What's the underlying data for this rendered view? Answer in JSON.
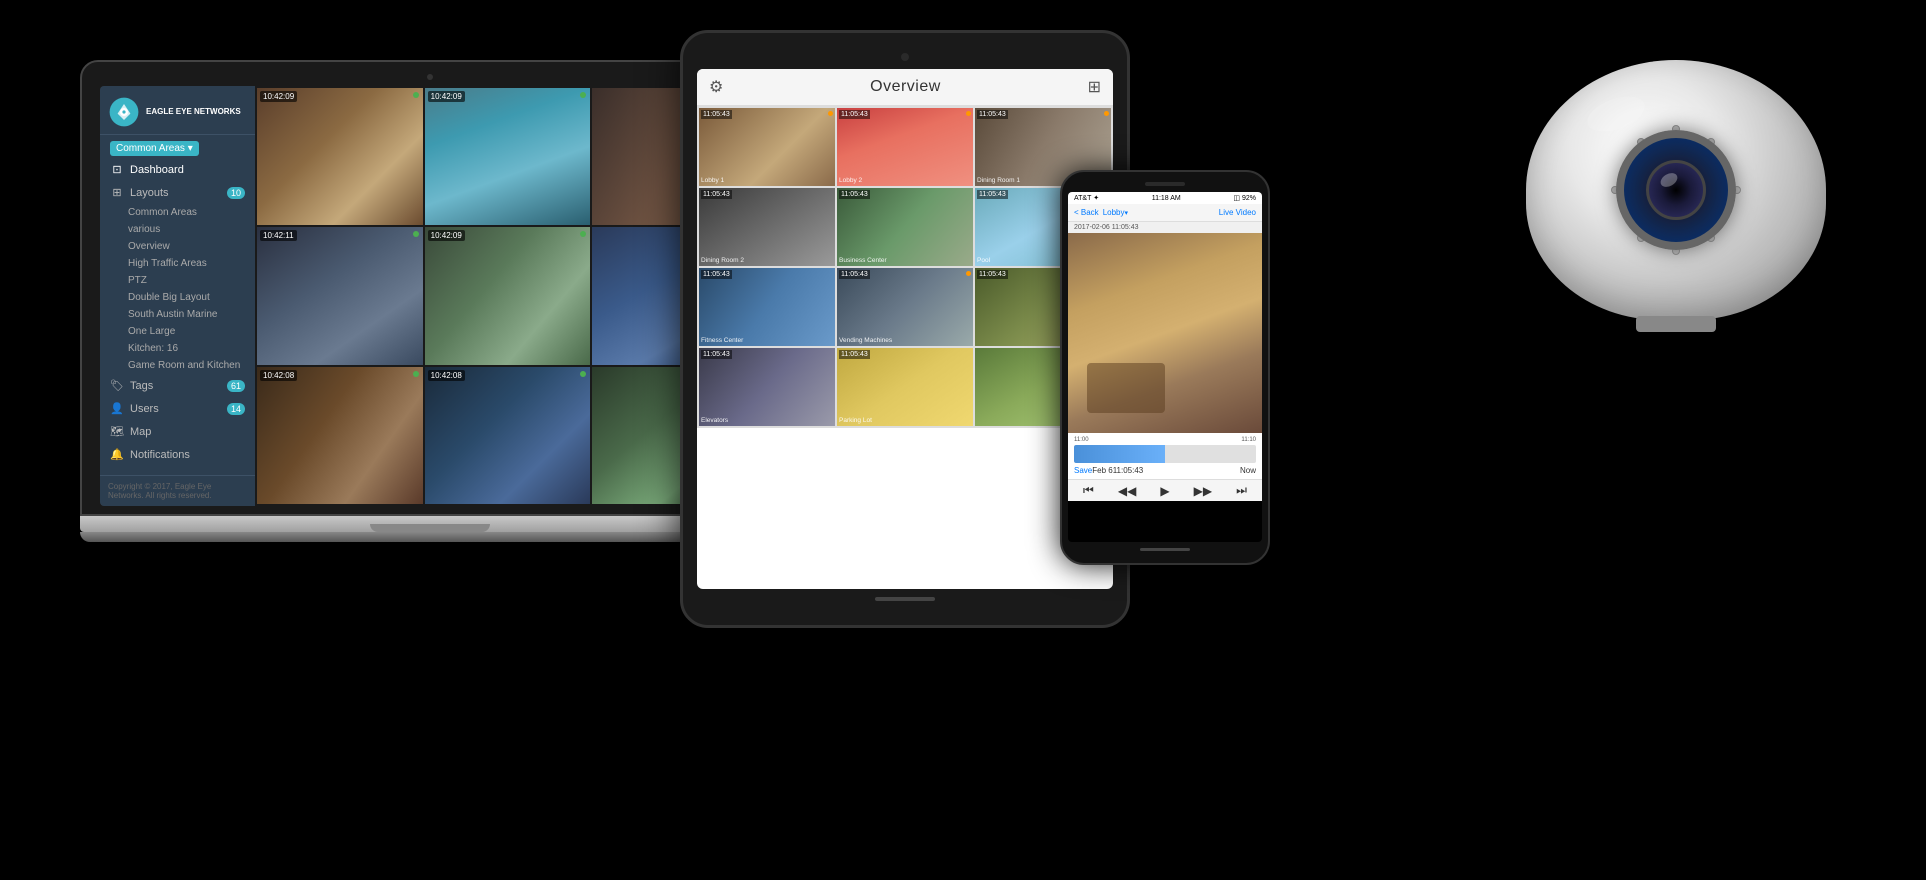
{
  "app": {
    "name": "Eagle Eye Networks"
  },
  "laptop": {
    "sidebar": {
      "logo_text": "EAGLE EYE\nNETWORKS, INC.",
      "location_label": "Common Areas ▾",
      "nav_items": [
        {
          "icon": "⊞",
          "label": "Dashboard",
          "badge": null
        },
        {
          "icon": "⊞",
          "label": "Layouts",
          "badge": "10"
        },
        {
          "icon": "🏷",
          "label": "Tags",
          "badge": "61"
        },
        {
          "icon": "👤",
          "label": "Users",
          "badge": "14"
        },
        {
          "icon": "🗺",
          "label": "Map",
          "badge": null
        },
        {
          "icon": "🔔",
          "label": "Notifications",
          "badge": null
        }
      ],
      "sub_items": [
        "Common Areas",
        "various",
        "Overview",
        "High Traffic Areas",
        "PTZ",
        "Double Big Layout",
        "South Austin Marine",
        "One Large",
        "Kitchen: 16",
        "Game Room and Kitchen"
      ],
      "footer": "Copyright © 2017, Eagle Eye Networks.\nAll rights reserved."
    },
    "cameras": [
      {
        "time": "10:42:09",
        "status": "green"
      },
      {
        "time": "10:42:09",
        "status": "green"
      },
      {
        "time": "",
        "status": ""
      },
      {
        "time": "10:42:11",
        "status": "green"
      },
      {
        "time": "10:42:09",
        "status": "green"
      },
      {
        "time": "",
        "status": ""
      },
      {
        "time": "10:42:08",
        "status": "green"
      },
      {
        "time": "10:42:08",
        "status": "green"
      },
      {
        "time": "",
        "status": ""
      }
    ]
  },
  "tablet": {
    "header": {
      "title": "Overview",
      "gear_icon": "⚙",
      "grid_icon": "⊞"
    },
    "cameras": [
      {
        "time": "11:05:43",
        "name": "Lobby 1",
        "dot": "orange"
      },
      {
        "time": "11:05:43",
        "name": "Lobby 2",
        "dot": "orange"
      },
      {
        "time": "11:05:43",
        "name": "Dining Room 1",
        "dot": "orange"
      },
      {
        "time": "11:05:43",
        "name": "Dining Room 2",
        "dot": ""
      },
      {
        "time": "11:05:43",
        "name": "Business Center",
        "dot": ""
      },
      {
        "time": "11:05:43",
        "name": "Pool",
        "dot": ""
      },
      {
        "time": "11:05:43",
        "name": "Fitness Center",
        "dot": ""
      },
      {
        "time": "11:05:43",
        "name": "Vending Machines",
        "dot": "orange"
      },
      {
        "time": "11:05:43",
        "name": "",
        "dot": ""
      },
      {
        "time": "11:05:43",
        "name": "Elevators",
        "dot": ""
      },
      {
        "time": "11:05:43",
        "name": "Parking Lot",
        "dot": ""
      },
      {
        "time": "",
        "name": "",
        "dot": ""
      }
    ]
  },
  "phone": {
    "status_bar": {
      "carrier": "AT&T ✦",
      "time": "11:18 AM",
      "battery": "◫ 92%"
    },
    "nav": {
      "back_label": "< Back",
      "location": "Lobby",
      "location_arrow": "▾",
      "live_label": "Live Video"
    },
    "date_label": "2017-02-06 11:05:43",
    "timeline": {
      "label_left": "11:00",
      "label_right": "11:10"
    },
    "controls": {
      "save_label": "Save",
      "date_label": "Feb 6",
      "time_label": "11:05:43",
      "now_label": "Now"
    },
    "playback": {
      "buttons": [
        "⏮",
        "◀◀",
        "▶",
        "▶▶",
        "⏭"
      ]
    }
  },
  "camera_device": {
    "type": "dome",
    "alt": "Security dome camera"
  }
}
